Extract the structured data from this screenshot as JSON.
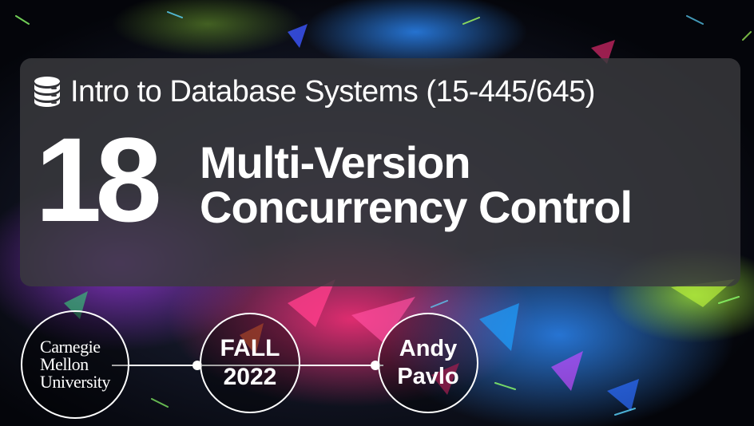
{
  "slide": {
    "course_title": "Intro to Database Systems (15-445/645)",
    "lecture_number": "18",
    "lecture_title_line1": "Multi-Version",
    "lecture_title_line2": "Concurrency Control",
    "university": {
      "line1": "Carnegie",
      "line2": "Mellon",
      "line3": "University"
    },
    "semester": {
      "line1": "FALL",
      "line2": "2022"
    },
    "instructor": {
      "line1": "Andy",
      "line2": "Pavlo"
    }
  },
  "icons": {
    "course_icon": "database-icon"
  },
  "colors": {
    "panel": "#3a3a3e",
    "text": "#ffffff",
    "background": "#05060c"
  }
}
